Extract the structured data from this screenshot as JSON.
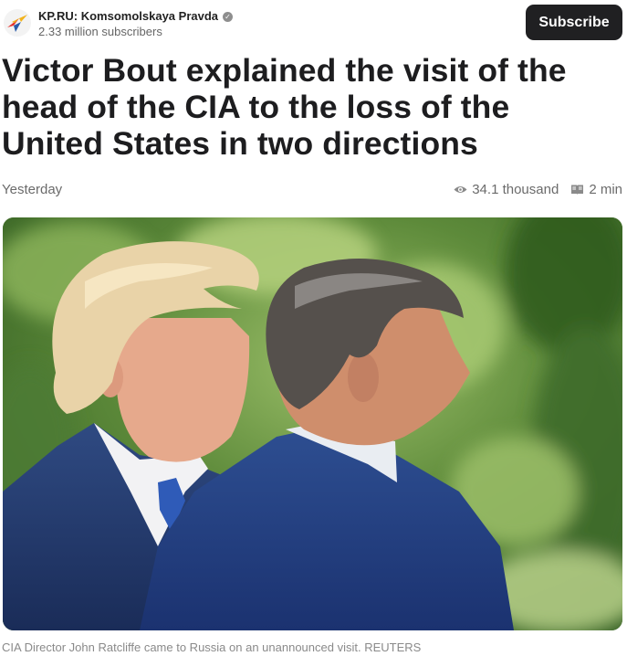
{
  "header": {
    "channel_name": "KP.RU: Komsomolskaya Pravda",
    "subscribers": "2.33 million subscribers",
    "subscribe_label": "Subscribe"
  },
  "article": {
    "title": "Victor Bout explained the visit of the head of the CIA to the loss of the United States in two directions",
    "date": "Yesterday",
    "views": "34.1 thousand",
    "read_time": "2 min",
    "caption": "CIA Director John Ratcliffe came to Russia on an unannounced visit. REUTERS"
  },
  "icons": {
    "logo": "kp-bird-logo",
    "verified": "verified-badge-icon",
    "views": "eye-icon",
    "read_time": "book-icon"
  },
  "colors": {
    "subscribe_bg": "#202022",
    "logo_red": "#e4342f",
    "logo_yellow": "#f2b31c",
    "logo_blue": "#2a5caa"
  }
}
